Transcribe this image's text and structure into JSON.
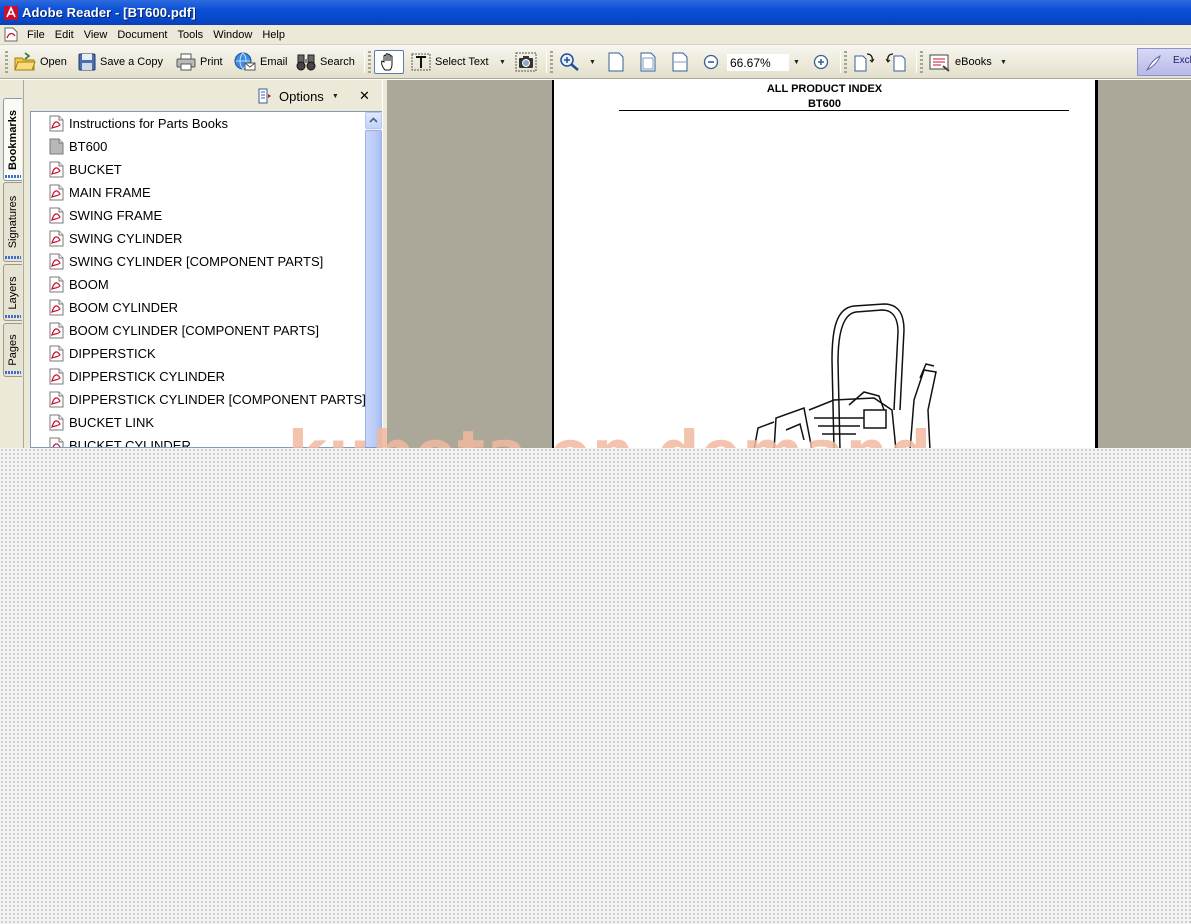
{
  "window": {
    "title": "Adobe Reader - [BT600.pdf]"
  },
  "menu": {
    "items": [
      "File",
      "Edit",
      "View",
      "Document",
      "Tools",
      "Window",
      "Help"
    ]
  },
  "toolbar": {
    "open_label": "Open",
    "save_copy_label": "Save a Copy",
    "print_label": "Print",
    "email_label": "Email",
    "search_label": "Search",
    "select_text_label": "Select Text",
    "zoom_value": "66.67%",
    "ebooks_label": "eBooks",
    "exclusive_label": "Excl"
  },
  "nav_tabs": {
    "bookmarks": "Bookmarks",
    "signatures": "Signatures",
    "layers": "Layers",
    "pages": "Pages"
  },
  "bookmarks_panel": {
    "options_label": "Options",
    "items": [
      {
        "label": "Instructions for Parts Books",
        "icon": "pdf-page-icon"
      },
      {
        "label": "BT600",
        "icon": "blank-page-icon"
      },
      {
        "label": "BUCKET",
        "icon": "pdf-page-icon"
      },
      {
        "label": "MAIN FRAME",
        "icon": "pdf-page-icon"
      },
      {
        "label": "SWING FRAME",
        "icon": "pdf-page-icon"
      },
      {
        "label": "SWING CYLINDER",
        "icon": "pdf-page-icon"
      },
      {
        "label": "SWING CYLINDER [COMPONENT PARTS]",
        "icon": "pdf-page-icon"
      },
      {
        "label": "BOOM",
        "icon": "pdf-page-icon"
      },
      {
        "label": "BOOM CYLINDER",
        "icon": "pdf-page-icon"
      },
      {
        "label": "BOOM CYLINDER [COMPONENT PARTS]",
        "icon": "pdf-page-icon"
      },
      {
        "label": "DIPPERSTICK",
        "icon": "pdf-page-icon"
      },
      {
        "label": "DIPPERSTICK CYLINDER",
        "icon": "pdf-page-icon"
      },
      {
        "label": "DIPPERSTICK CYLINDER [COMPONENT PARTS]",
        "icon": "pdf-page-icon"
      },
      {
        "label": "BUCKET LINK",
        "icon": "pdf-page-icon"
      },
      {
        "label": "BUCKET CYLINDER",
        "icon": "pdf-page-icon"
      }
    ]
  },
  "document": {
    "heading": "ALL PRODUCT INDEX",
    "subheading": "BT600",
    "watermark": "kubota on demand"
  },
  "colors": {
    "titlebar_blue": "#0a4fd6",
    "chrome": "#ece9d8",
    "doc_background": "#aca899"
  }
}
